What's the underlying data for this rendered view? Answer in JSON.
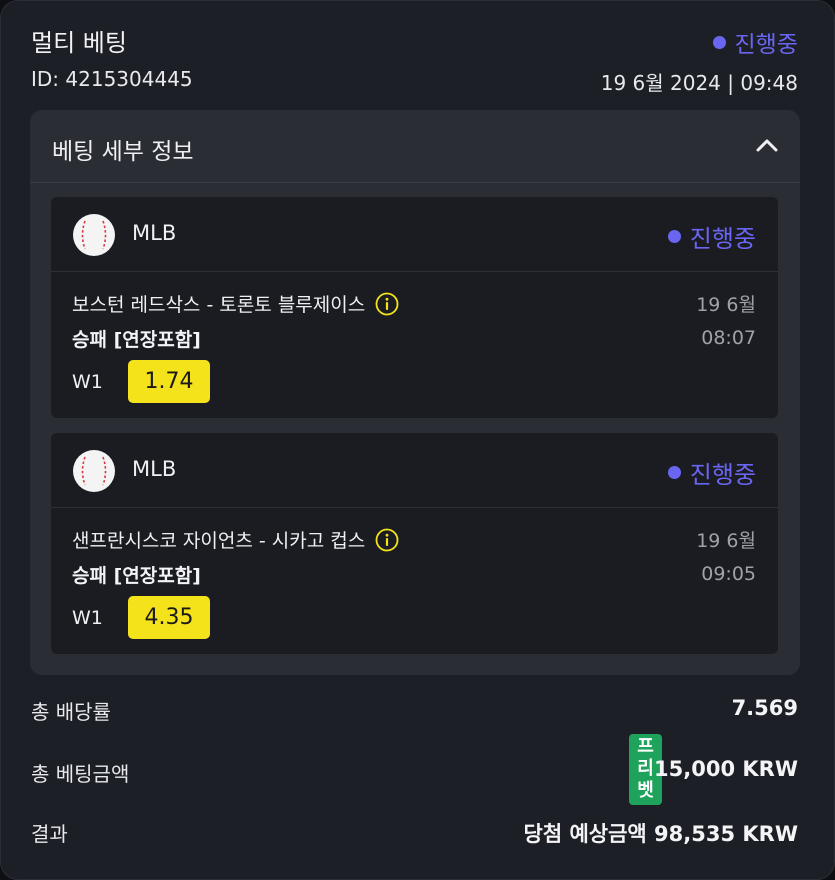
{
  "bet": {
    "title": "멀티 베팅",
    "status": "진행중",
    "id_text": "ID: 4215304445",
    "datetime": "19 6월 2024 | 09:48"
  },
  "details": {
    "header": "베팅 세부 정보",
    "events": [
      {
        "league": "MLB",
        "status": "진행중",
        "match": "보스턴 레드삭스 - 토론토 블루제이스",
        "market": "승패 [연장포함]",
        "date": "19 6월",
        "time": "08:07",
        "outcome": "W1",
        "odds": "1.74"
      },
      {
        "league": "MLB",
        "status": "진행중",
        "match": "샌프란시스코 자이언츠 - 시카고 컵스",
        "market": "승패 [연장포함]",
        "date": "19 6월",
        "time": "09:05",
        "outcome": "W1",
        "odds": "4.35"
      }
    ]
  },
  "summary": {
    "total_odds_label": "총 배당률",
    "total_odds_value": "7.569",
    "total_stake_label": "총 베팅금액",
    "freebet_badge": [
      "프",
      "리",
      "벳"
    ],
    "total_stake_value": "15,000 KRW",
    "result_label": "결과",
    "result_value": "당첨 예상금액 98,535 KRW"
  },
  "colors": {
    "status_accent": "#6a66f2",
    "odds_highlight": "#f4e21a",
    "freebet_badge": "#1fa35c"
  },
  "icons": [
    "baseball-icon",
    "info-icon",
    "chevron-up-icon"
  ]
}
